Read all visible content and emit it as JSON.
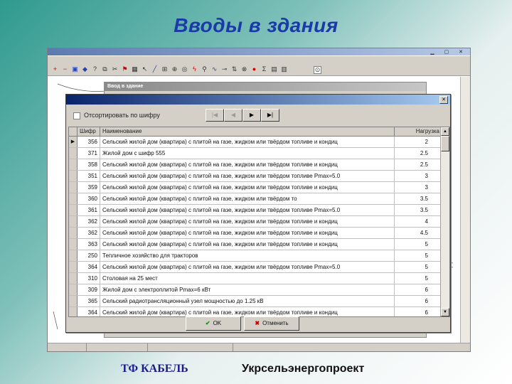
{
  "slide": {
    "title": "Вводы в здания",
    "footer_left": "ТФ КАБЕЛЬ",
    "footer_right": "Укрсельэнергопроект"
  },
  "background_form": {
    "title": "Ввод в здание"
  },
  "dialog": {
    "sort_checkbox_label": "Отсортировать по шифру",
    "sort_checked": false,
    "nav_buttons": [
      "first",
      "prev",
      "next",
      "last"
    ],
    "columns": [
      "Шифр",
      "Наименование",
      "Нагрузка"
    ],
    "rows": [
      {
        "code": "356",
        "name": "Сельский жилой дом (квартира) с плитой на газе, жидком или твёрдом топливе и кондиц",
        "load": "2",
        "current": true
      },
      {
        "code": "371",
        "name": "Жилой дом с шифр 555",
        "load": "2.5"
      },
      {
        "code": "358",
        "name": "Сельский жилой дом (квартира) с плитой на газе, жидком или твёрдом топливе и кондиц",
        "load": "2.5"
      },
      {
        "code": "351",
        "name": "Сельский жилой дом (квартира) с плитой на газе, жидком или твёрдом топливе Pmax=5.0",
        "load": "3"
      },
      {
        "code": "359",
        "name": "Сельский жилой дом (квартира) с плитой на газе, жидком или твёрдом топливе и кондиц",
        "load": "3"
      },
      {
        "code": "360",
        "name": "Сельский жилой дом (квартира) с плитой на газе, жидком или твёрдом то",
        "load": "3.5"
      },
      {
        "code": "361",
        "name": "Сельский жилой дом (квартира) с плитой на газе, жидком или твёрдом топливе Pmax=5.0",
        "load": "3.5"
      },
      {
        "code": "362",
        "name": "Сельский жилой дом (квартира) с плитой на газе, жидком или твёрдом топливе и кондиц",
        "load": "4"
      },
      {
        "code": "362",
        "name": "Сельский жилой дом (квартира) с плитой на газе, жидком или твёрдом топливе и кондиц",
        "load": "4.5"
      },
      {
        "code": "363",
        "name": "Сельский жилой дом (квартира) с плитой на газе, жидком или твёрдом топливе и кондиц",
        "load": "5"
      },
      {
        "code": "250",
        "name": "Тепличное хозяйство для тракторов",
        "load": "5"
      },
      {
        "code": "364",
        "name": "Сельский жилой дом (квартира) с плитой на газе, жидком или твёрдом топливе Pmax=5.0",
        "load": "5"
      },
      {
        "code": "310",
        "name": "Столовая на 25 мест",
        "load": "5"
      },
      {
        "code": "309",
        "name": "Жилой дом с электроплитой Pmax=6 кВт",
        "load": "6"
      },
      {
        "code": "365",
        "name": "Сельский радиотрансляционный узел мощностью до 1.25 кВ",
        "load": "6"
      },
      {
        "code": "364",
        "name": "Сельский жилой дом (квартира) с плитой на газе, жидком или твёрдом топливе и кондиц",
        "load": "6"
      }
    ],
    "ok_label": "OK",
    "cancel_label": "Отменить"
  }
}
